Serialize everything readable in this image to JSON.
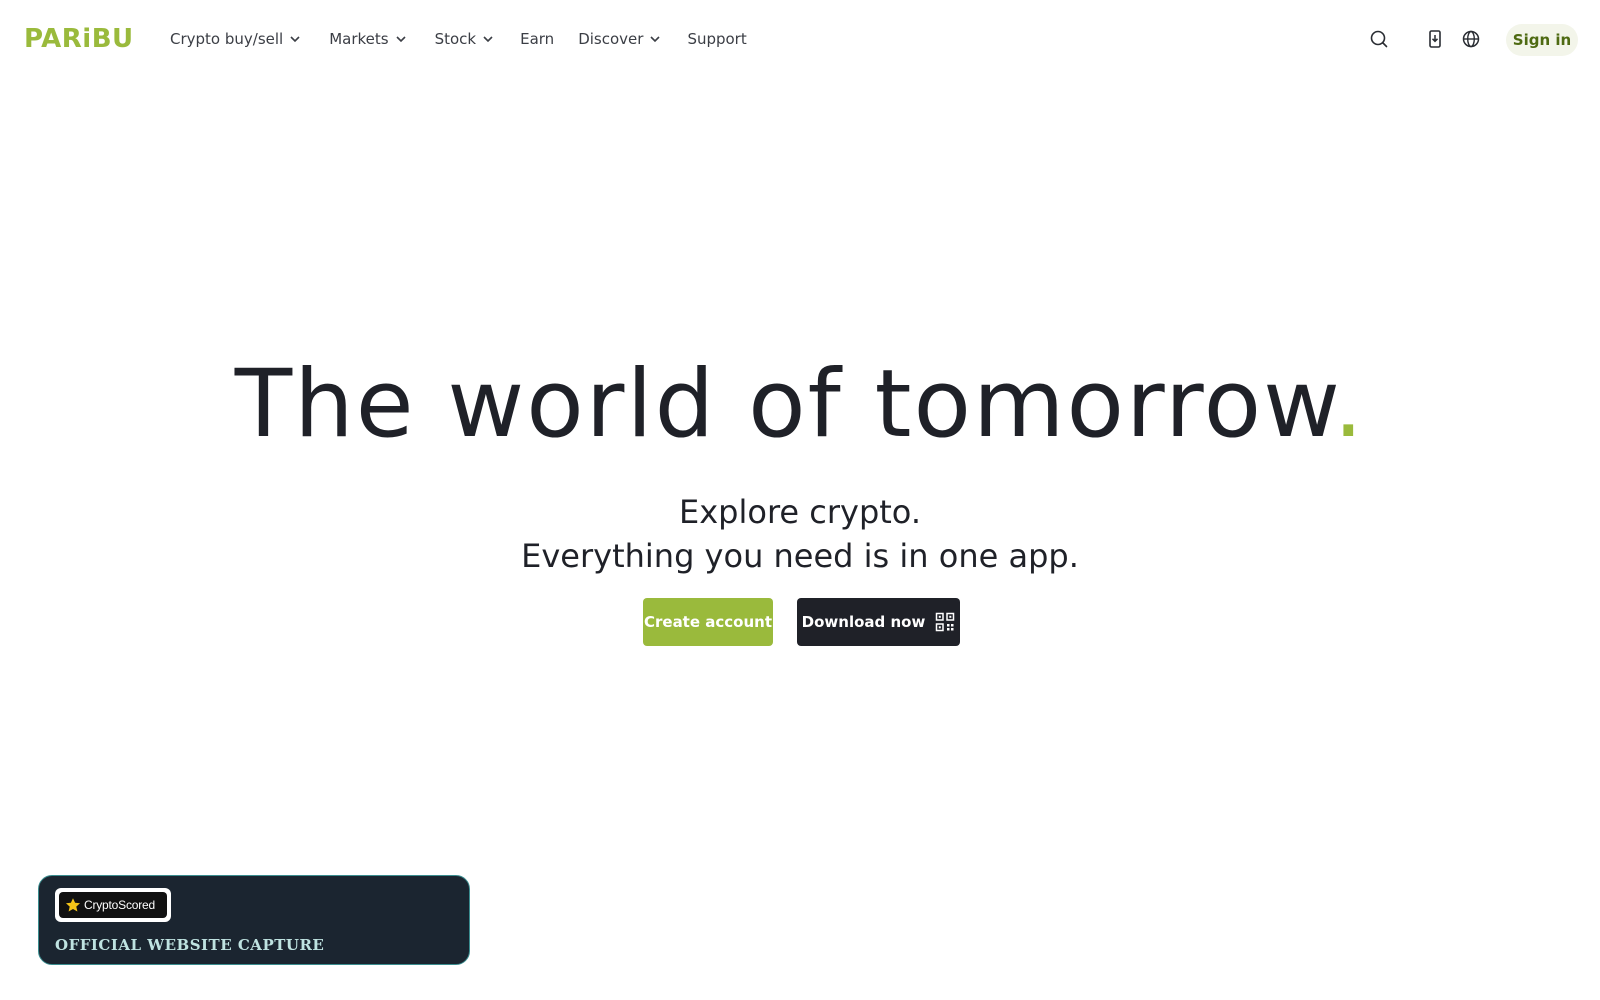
{
  "header": {
    "logo": "PARiBU",
    "nav": [
      {
        "label": "Crypto buy/sell",
        "has_dropdown": true
      },
      {
        "label": "Markets",
        "has_dropdown": true
      },
      {
        "label": "Stock",
        "has_dropdown": true
      },
      {
        "label": "Earn",
        "has_dropdown": false
      },
      {
        "label": "Discover",
        "has_dropdown": true
      },
      {
        "label": "Support",
        "has_dropdown": false
      }
    ],
    "icons": [
      "search-icon",
      "download-app-icon",
      "globe-icon"
    ],
    "sign_in_label": "Sign in"
  },
  "hero": {
    "title": "The world of tomorrow",
    "title_dot": ".",
    "subtitle_line1": "Explore crypto.",
    "subtitle_line2": "Everything you need is in one app.",
    "create_account_label": "Create account",
    "download_now_label": "Download now"
  },
  "badge": {
    "brand": "CryptoScored",
    "caption": "OFFICIAL WEBSITE CAPTURE"
  },
  "colors": {
    "brand_green": "#9aba3c",
    "dark": "#1f2128",
    "signin_bg": "#f3f5ea",
    "signin_text": "#4e6a12",
    "badge_bg": "#1b2530",
    "badge_border": "#3a8d8f"
  }
}
